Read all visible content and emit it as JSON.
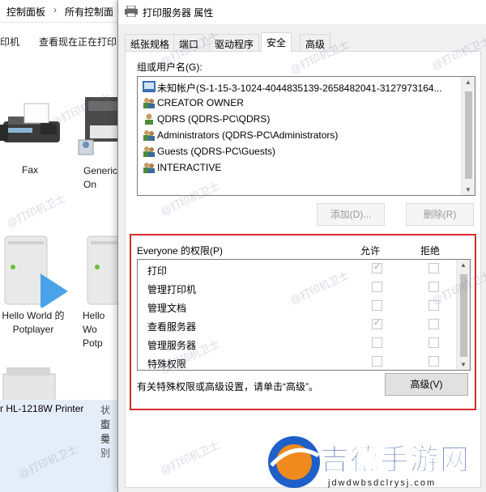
{
  "explorer": {
    "breadcrumb": [
      "控制面板",
      "所有控制面"
    ],
    "toolbar": [
      "印机",
      "查看现在正在打印"
    ],
    "devices": [
      {
        "label": "Fax"
      },
      {
        "label": "Generic\nOn"
      },
      {
        "label": "Hello World 的\nPotplayer"
      },
      {
        "label": "Hello Wo\nPotp"
      }
    ],
    "printer_name": "r HL-1218W Printer",
    "status_labels": [
      "状态",
      "型号",
      "类别"
    ]
  },
  "dialog": {
    "title": "打印服务器 属性",
    "tabs": [
      "纸张规格",
      "端口",
      "驱动程序",
      "安全",
      "高级"
    ],
    "active_tab": "安全",
    "groups_label": "组或用户名(G):",
    "users": [
      {
        "name": "未知帐户(S-1-15-3-1024-4044835139-2658482041-3127973164...",
        "icon": "unknown-account-icon"
      },
      {
        "name": "CREATOR OWNER",
        "icon": "group-icon"
      },
      {
        "name": "QDRS (QDRS-PC\\QDRS)",
        "icon": "user-icon"
      },
      {
        "name": "Administrators (QDRS-PC\\Administrators)",
        "icon": "group-icon"
      },
      {
        "name": "Guests (QDRS-PC\\Guests)",
        "icon": "group-icon"
      },
      {
        "name": "INTERACTIVE",
        "icon": "group-icon"
      }
    ],
    "add_button": "添加(D)...",
    "remove_button": "删除(R)",
    "permissions_label": "Everyone 的权限(P)",
    "allow_header": "允许",
    "deny_header": "拒绝",
    "permissions": [
      {
        "name": "打印",
        "allow": true,
        "deny": false
      },
      {
        "name": "管理打印机",
        "allow": false,
        "deny": false
      },
      {
        "name": "管理文档",
        "allow": false,
        "deny": false
      },
      {
        "name": "查看服务器",
        "allow": true,
        "deny": false
      },
      {
        "name": "管理服务器",
        "allow": false,
        "deny": false
      },
      {
        "name": "特殊权限",
        "allow": false,
        "deny": false
      }
    ],
    "note": "有关特殊权限或高级设置，请单击“高级”。",
    "advanced_button": "高级(V)"
  },
  "watermark": "@打印机卫士",
  "site_logo": {
    "text": "吉德手游网",
    "url_text": "jdwdwbsdclrysj.com"
  },
  "colors": {
    "highlight_border": "#d42b2b",
    "logo_blue": "#1f5fc8",
    "logo_orange": "#f08a1c"
  }
}
